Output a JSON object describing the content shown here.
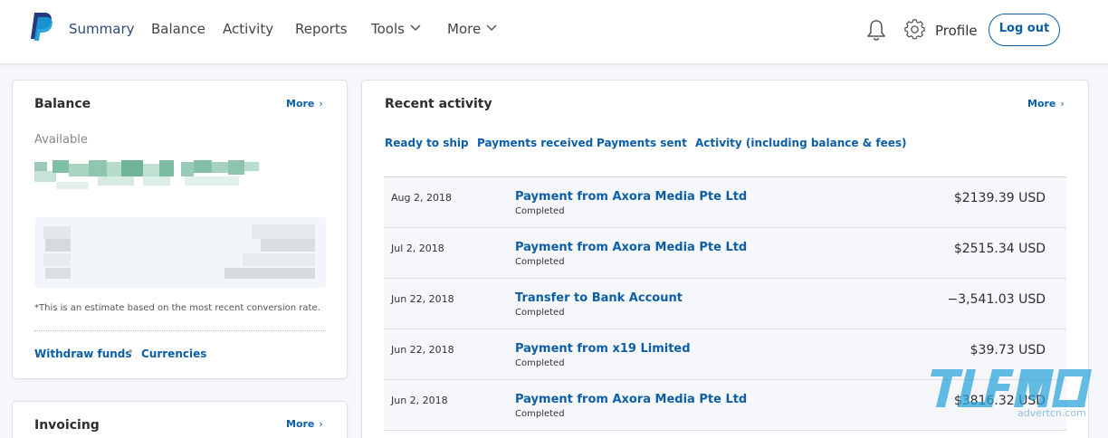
{
  "nav": {
    "summary": "Summary",
    "balance": "Balance",
    "activity": "Activity",
    "reports": "Reports",
    "tools": "Tools",
    "more": "More",
    "profile": "Profile",
    "logout": "Log out"
  },
  "balance_card": {
    "title": "Balance",
    "more": "More",
    "available_label": "Available",
    "estimate_note": "*This is an estimate based on the most recent conversion rate.",
    "withdraw": "Withdraw funds",
    "currencies": "Currencies"
  },
  "invoicing_card": {
    "title": "Invoicing",
    "more": "More"
  },
  "activity_card": {
    "title": "Recent activity",
    "more": "More",
    "filters": [
      "Ready to ship",
      "Payments received",
      "Payments sent",
      "Activity (including balance & fees)"
    ],
    "rows": [
      {
        "date": "Aug 2, 2018",
        "description": "Payment from Axora Media Pte Ltd",
        "status": "Completed",
        "amount": "$2139.39 USD"
      },
      {
        "date": "Jul 2, 2018",
        "description": "Payment from Axora Media Pte Ltd",
        "status": "Completed",
        "amount": "$2515.34 USD"
      },
      {
        "date": "Jun 22, 2018",
        "description": "Transfer to Bank Account",
        "status": "Completed",
        "amount": "−3,541.03 USD"
      },
      {
        "date": "Jun 22, 2018",
        "description": "Payment from x19 Limited",
        "status": "Completed",
        "amount": "$39.73 USD"
      },
      {
        "date": "Jun 2, 2018",
        "description": "Payment from Axora Media Pte Ltd",
        "status": "Completed",
        "amount": "$3816.32 USD"
      }
    ]
  },
  "watermark_text": "advertcn.com",
  "colors": {
    "brand_blue": "#0c5ea6",
    "nav_active": "#2c4a7a",
    "page_bg": "#f5f7fa"
  }
}
